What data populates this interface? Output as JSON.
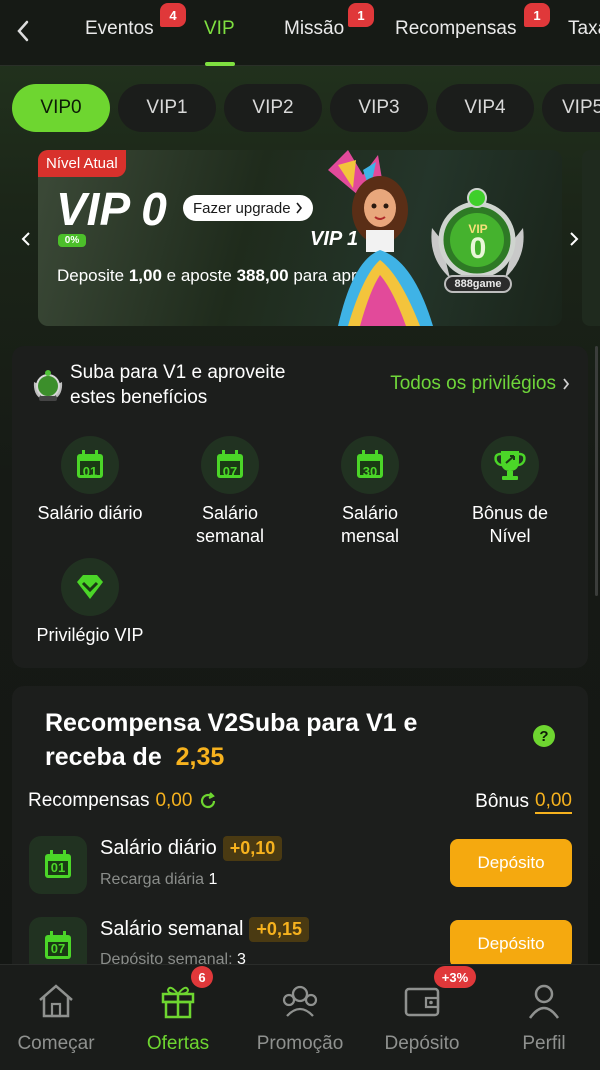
{
  "topnav": {
    "tabs": [
      {
        "label": "Eventos",
        "badge": "4"
      },
      {
        "label": "VIP",
        "badge": ""
      },
      {
        "label": "Missão",
        "badge": "1"
      },
      {
        "label": "Recompensas",
        "badge": "1"
      },
      {
        "label": "Taxa",
        "badge": ""
      }
    ],
    "active_tab": "VIP"
  },
  "vip_levels": [
    "VIP0",
    "VIP1",
    "VIP2",
    "VIP3",
    "VIP4",
    "VIP5"
  ],
  "active_level": "VIP0",
  "banner": {
    "current_level_tag": "Nível Atual",
    "level": "VIP 0",
    "upgrade_label": "Fazer upgrade",
    "progress_label": "0%",
    "progress": 0,
    "text_pre": "Deposite ",
    "deposit": "1,00",
    "text_mid": " e aposte ",
    "bet": "388,00",
    "text_post": " para apro",
    "next_level": "VIP 1",
    "medal_level": "0",
    "medal_top": "VIP",
    "medal_brand": "888game"
  },
  "benefits": {
    "title": "Suba para V1 e aproveite estes benefícios",
    "all_link": "Todos os privilégios",
    "items": [
      {
        "label": "Salário diário",
        "icon_num": "01"
      },
      {
        "label": "Salário semanal",
        "icon_num": "07"
      },
      {
        "label": "Salário mensal",
        "icon_num": "30"
      },
      {
        "label": "Bônus de Nível",
        "icon_num": ""
      },
      {
        "label": "Privilégio VIP",
        "icon_num": ""
      }
    ]
  },
  "rewards": {
    "title": "Recompensa V2Suba para V1 e receba de",
    "amount": "2,35",
    "rewards_label": "Recompensas",
    "rewards_value": "0,00",
    "bonus_label": "Bônus",
    "bonus_value": "0,00",
    "rows": [
      {
        "name": "Salário diário",
        "tag": "+0,10",
        "sub_label": "Recarga diária",
        "sub_value": "1",
        "button": "Depósito",
        "icon_num": "01"
      },
      {
        "name": "Salário semanal",
        "tag": "+0,15",
        "sub_label": "Depósito semanal:",
        "sub_value": "3",
        "button": "Depósito",
        "icon_num": "07"
      }
    ]
  },
  "bottombar": {
    "items": [
      {
        "label": "Começar",
        "badge": ""
      },
      {
        "label": "Ofertas",
        "badge": "6"
      },
      {
        "label": "Promoção",
        "badge": ""
      },
      {
        "label": "Depósito",
        "badge": "+3%"
      },
      {
        "label": "Perfil",
        "badge": ""
      }
    ],
    "active": "Ofertas"
  },
  "colors": {
    "accent": "#6ed630",
    "gold": "#f6b21e",
    "badge_red": "#e0383a",
    "button_orange": "#f5a90f"
  }
}
